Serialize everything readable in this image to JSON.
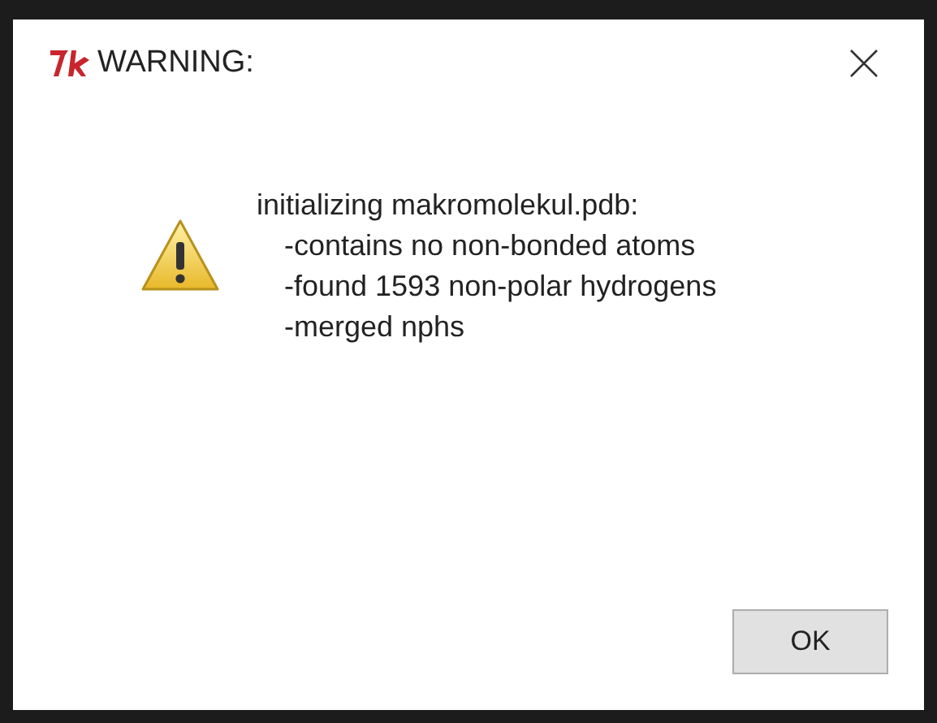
{
  "window": {
    "title": "WARNING:"
  },
  "message": {
    "heading": "initializing makromolekul.pdb:",
    "items": [
      "-contains no non-bonded atoms",
      "-found 1593 non-polar hydrogens",
      "-merged nphs"
    ]
  },
  "buttons": [
    {
      "label": "OK"
    }
  ]
}
